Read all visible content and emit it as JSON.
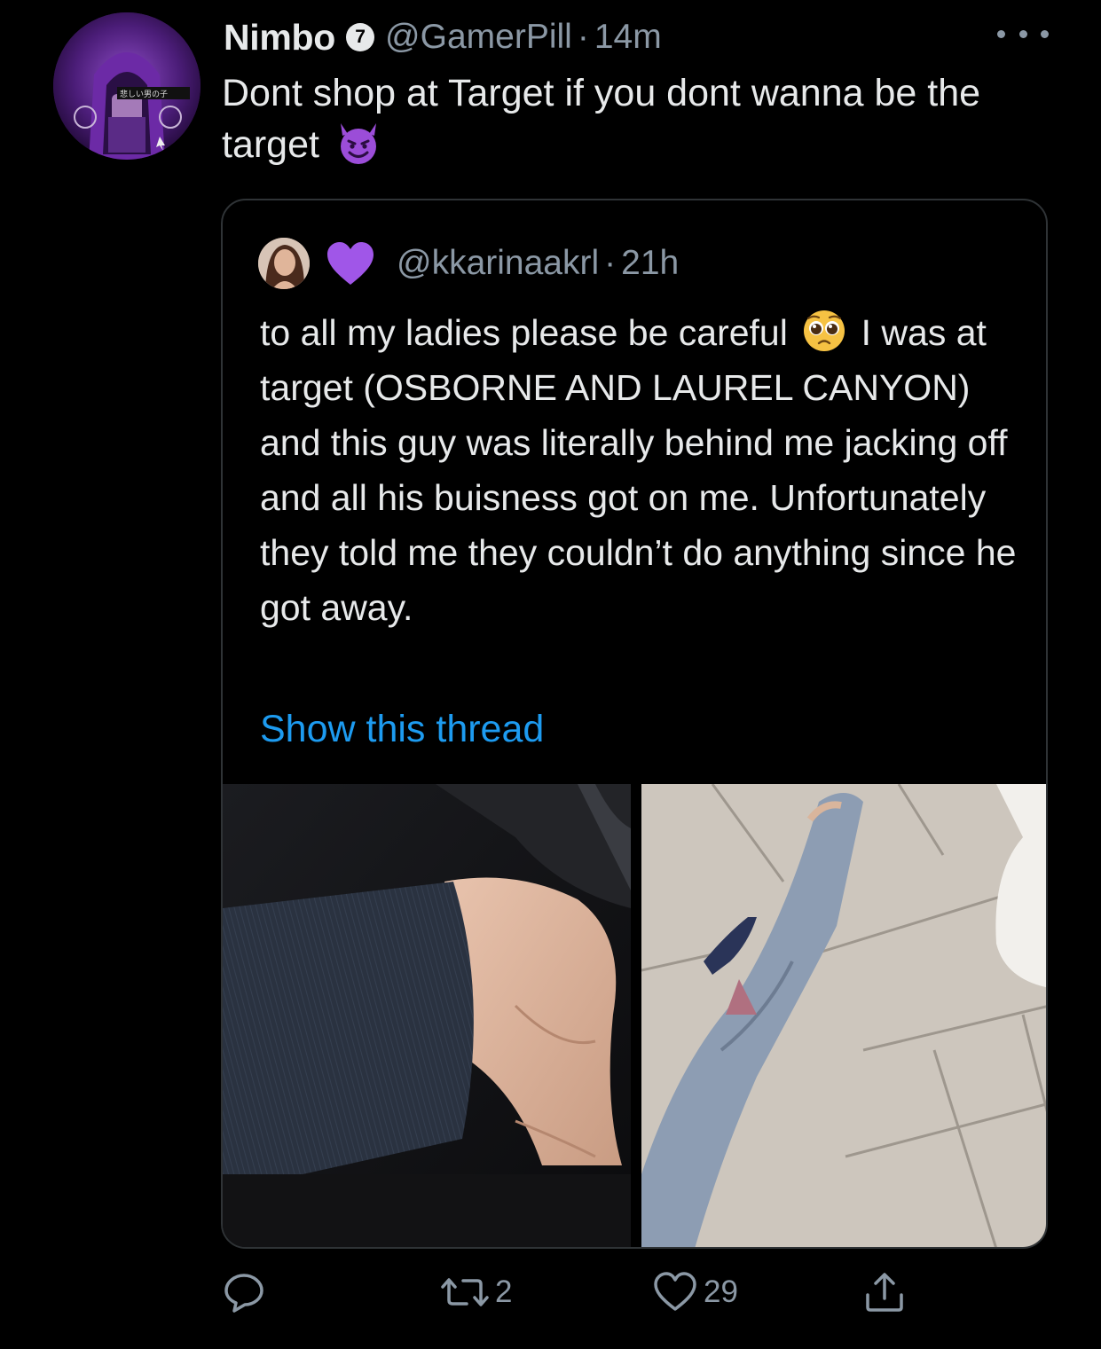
{
  "tweet": {
    "display_name": "Nimbo",
    "badge": "7",
    "handle": "@GamerPill",
    "separator": "·",
    "time": "14m",
    "text": "Dont shop at Target if you dont wanna be the target",
    "emoji": "smiling-devil-emoji",
    "avatar_text": "悲しい男の子"
  },
  "quote": {
    "handle": "@kkarinaakrl",
    "separator": "·",
    "time": "21h",
    "text_before_emoji": "to all my ladies please be careful",
    "text_after_emoji": "I was at target (OSBORNE AND LAUREL CANYON) and this guy was literally behind me jacking off and all his buisness got on me. Unfortunately they told me they couldn’t do anything since he got away.",
    "emoji": "pleading-face-emoji",
    "name_emoji": "purple-heart-emoji",
    "show_thread": "Show this thread"
  },
  "actions": {
    "reply_count": "",
    "retweet_count": "2",
    "like_count": "29"
  },
  "colors": {
    "background": "#000000",
    "text": "#e7e9ea",
    "secondary": "#8b98a5",
    "link": "#1d9bf0",
    "border": "#2f3336"
  }
}
